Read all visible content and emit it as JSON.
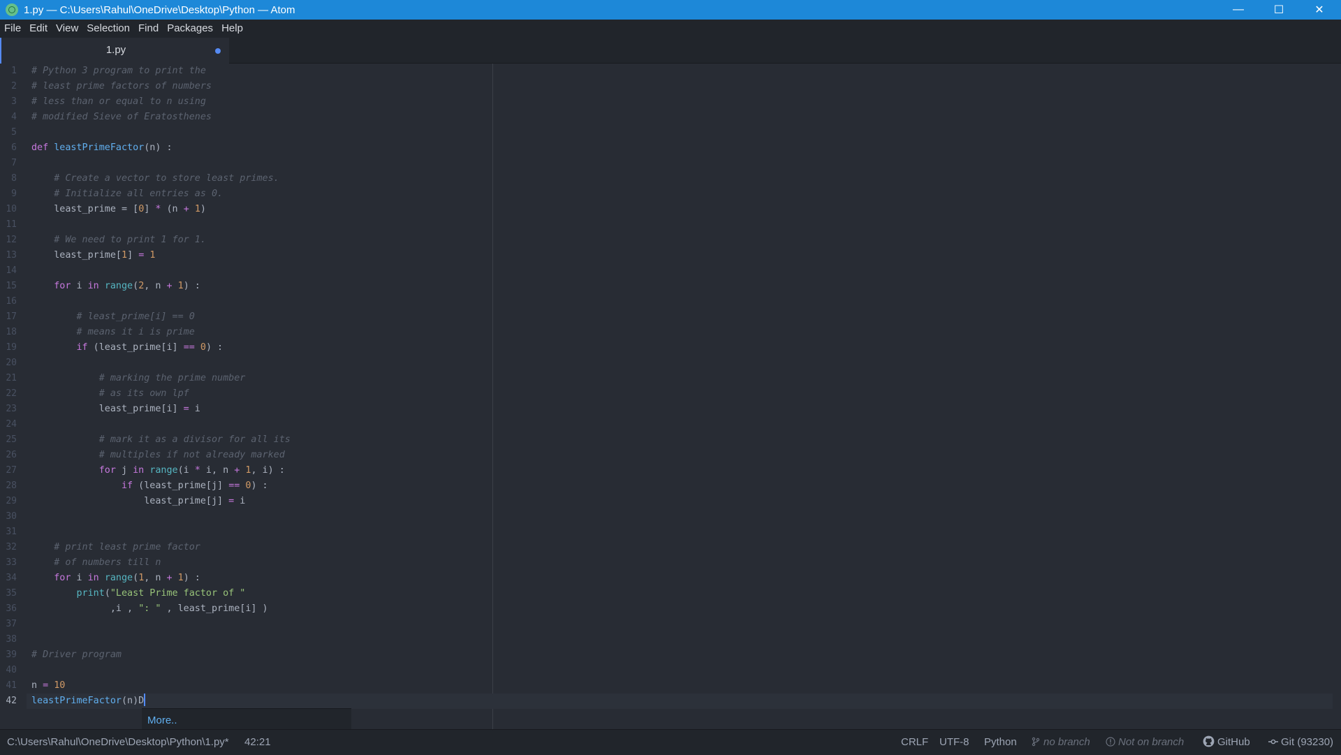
{
  "window": {
    "title": "1.py — C:\\Users\\Rahul\\OneDrive\\Desktop\\Python — Atom",
    "minimize_glyph": "—",
    "maximize_glyph": "☐",
    "close_glyph": "✕"
  },
  "menu": [
    "File",
    "Edit",
    "View",
    "Selection",
    "Find",
    "Packages",
    "Help"
  ],
  "tab": {
    "title": "1.py",
    "modified": true
  },
  "editor": {
    "current_line": 42,
    "lines": [
      [
        [
          "comment",
          "# Python 3 program to print the"
        ]
      ],
      [
        [
          "comment",
          "# least prime factors of numbers"
        ]
      ],
      [
        [
          "comment",
          "# less than or equal to n using"
        ]
      ],
      [
        [
          "comment",
          "# modified Sieve of Eratosthenes"
        ]
      ],
      [],
      [
        [
          "keyword",
          "def "
        ],
        [
          "function",
          "leastPrimeFactor"
        ],
        [
          "text",
          "(n) :"
        ]
      ],
      [],
      [
        [
          "text",
          "    "
        ],
        [
          "comment",
          "# Create a vector to store least primes."
        ]
      ],
      [
        [
          "text",
          "    "
        ],
        [
          "comment",
          "# Initialize all entries as 0."
        ]
      ],
      [
        [
          "text",
          "    least_prime = ["
        ],
        [
          "number",
          "0"
        ],
        [
          "text",
          "] "
        ],
        [
          "operator",
          "*"
        ],
        [
          "text",
          " (n "
        ],
        [
          "operator",
          "+"
        ],
        [
          "text",
          " "
        ],
        [
          "number",
          "1"
        ],
        [
          "text",
          ")"
        ]
      ],
      [],
      [
        [
          "text",
          "    "
        ],
        [
          "comment",
          "# We need to print 1 for 1."
        ]
      ],
      [
        [
          "text",
          "    least_prime["
        ],
        [
          "number",
          "1"
        ],
        [
          "text",
          "] "
        ],
        [
          "operator",
          "="
        ],
        [
          "text",
          " "
        ],
        [
          "number",
          "1"
        ]
      ],
      [],
      [
        [
          "text",
          "    "
        ],
        [
          "keyword",
          "for"
        ],
        [
          "text",
          " i "
        ],
        [
          "keyword",
          "in"
        ],
        [
          "text",
          " "
        ],
        [
          "builtin",
          "range"
        ],
        [
          "text",
          "("
        ],
        [
          "number",
          "2"
        ],
        [
          "text",
          ", n "
        ],
        [
          "operator",
          "+"
        ],
        [
          "text",
          " "
        ],
        [
          "number",
          "1"
        ],
        [
          "text",
          ") :"
        ]
      ],
      [],
      [
        [
          "text",
          "        "
        ],
        [
          "comment",
          "# least_prime[i] == 0"
        ]
      ],
      [
        [
          "text",
          "        "
        ],
        [
          "comment",
          "# means it i is prime"
        ]
      ],
      [
        [
          "text",
          "        "
        ],
        [
          "keyword",
          "if"
        ],
        [
          "text",
          " (least_prime[i] "
        ],
        [
          "operator",
          "=="
        ],
        [
          "text",
          " "
        ],
        [
          "number",
          "0"
        ],
        [
          "text",
          ") :"
        ]
      ],
      [],
      [
        [
          "text",
          "            "
        ],
        [
          "comment",
          "# marking the prime number"
        ]
      ],
      [
        [
          "text",
          "            "
        ],
        [
          "comment",
          "# as its own lpf"
        ]
      ],
      [
        [
          "text",
          "            least_prime[i] "
        ],
        [
          "operator",
          "="
        ],
        [
          "text",
          " i"
        ]
      ],
      [],
      [
        [
          "text",
          "            "
        ],
        [
          "comment",
          "# mark it as a divisor for all its"
        ]
      ],
      [
        [
          "text",
          "            "
        ],
        [
          "comment",
          "# multiples if not already marked"
        ]
      ],
      [
        [
          "text",
          "            "
        ],
        [
          "keyword",
          "for"
        ],
        [
          "text",
          " j "
        ],
        [
          "keyword",
          "in"
        ],
        [
          "text",
          " "
        ],
        [
          "builtin",
          "range"
        ],
        [
          "text",
          "(i "
        ],
        [
          "operator",
          "*"
        ],
        [
          "text",
          " i, n "
        ],
        [
          "operator",
          "+"
        ],
        [
          "text",
          " "
        ],
        [
          "number",
          "1"
        ],
        [
          "text",
          ", i) :"
        ]
      ],
      [
        [
          "text",
          "                "
        ],
        [
          "keyword",
          "if"
        ],
        [
          "text",
          " (least_prime[j] "
        ],
        [
          "operator",
          "=="
        ],
        [
          "text",
          " "
        ],
        [
          "number",
          "0"
        ],
        [
          "text",
          ") :"
        ]
      ],
      [
        [
          "text",
          "                    least_prime[j] "
        ],
        [
          "operator",
          "="
        ],
        [
          "text",
          " i"
        ]
      ],
      [],
      [],
      [
        [
          "text",
          "    "
        ],
        [
          "comment",
          "# print least prime factor"
        ]
      ],
      [
        [
          "text",
          "    "
        ],
        [
          "comment",
          "# of numbers till n"
        ]
      ],
      [
        [
          "text",
          "    "
        ],
        [
          "keyword",
          "for"
        ],
        [
          "text",
          " i "
        ],
        [
          "keyword",
          "in"
        ],
        [
          "text",
          " "
        ],
        [
          "builtin",
          "range"
        ],
        [
          "text",
          "("
        ],
        [
          "number",
          "1"
        ],
        [
          "text",
          ", n "
        ],
        [
          "operator",
          "+"
        ],
        [
          "text",
          " "
        ],
        [
          "number",
          "1"
        ],
        [
          "text",
          ") :"
        ]
      ],
      [
        [
          "text",
          "        "
        ],
        [
          "builtin",
          "print"
        ],
        [
          "text",
          "("
        ],
        [
          "string",
          "\"Least Prime factor of \""
        ]
      ],
      [
        [
          "text",
          "              ,i , "
        ],
        [
          "string",
          "\": \""
        ],
        [
          "text",
          " , least_prime[i] )"
        ]
      ],
      [],
      [],
      [
        [
          "comment",
          "# Driver program"
        ]
      ],
      [],
      [
        [
          "text",
          "n "
        ],
        [
          "operator",
          "="
        ],
        [
          "text",
          " "
        ],
        [
          "number",
          "10"
        ]
      ],
      [
        [
          "function",
          "leastPrimeFactor"
        ],
        [
          "text",
          "(n)D"
        ]
      ]
    ]
  },
  "autocomplete": {
    "more_label": "More.."
  },
  "statusbar": {
    "file_path": "C:\\Users\\Rahul\\OneDrive\\Desktop\\Python\\1.py*",
    "cursor_position": "42:21",
    "line_ending": "CRLF",
    "encoding": "UTF-8",
    "grammar": "Python",
    "branch": "no branch",
    "git_status": "Not on branch",
    "github_label": "GitHub",
    "git_label": "Git (93230)"
  },
  "colors": {
    "titlebar": "#1d88d8",
    "editor_bg": "#282c34",
    "chrome_bg": "#21252b",
    "accent": "#568af2"
  }
}
